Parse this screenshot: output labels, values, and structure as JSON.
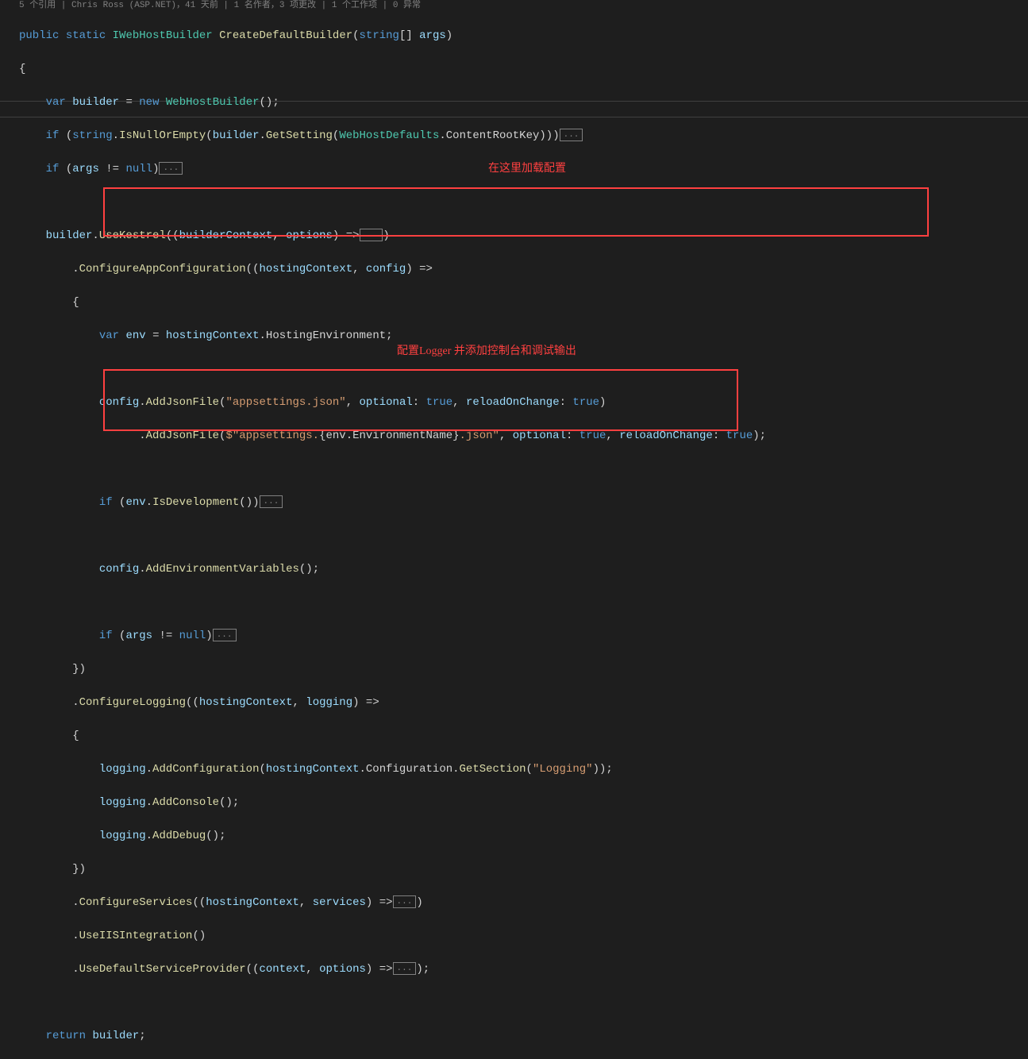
{
  "codelens": "5 个引用 | Chris Ross (ASP.NET)，41 天前 | 1 名作者，3 项更改 | 1 个工作项 | 0 异常",
  "collapsed": "...",
  "annotations": {
    "a1": "在这里加载配置",
    "a2": "配置Logger 并添加控制台和调试输出"
  },
  "tokens": {
    "public": "public",
    "static": "static",
    "IWebHostBuilder": "IWebHostBuilder",
    "CreateDefaultBuilder": "CreateDefaultBuilder",
    "string": "string",
    "brackets": "[]",
    "args": "args",
    "var": "var",
    "builder": "builder",
    "new": "new",
    "WebHostBuilder": "WebHostBuilder",
    "if": "if",
    "IsNullOrEmpty": "IsNullOrEmpty",
    "GetSetting": "GetSetting",
    "WebHostDefaults": "WebHostDefaults",
    "ContentRootKey": "ContentRootKey",
    "null": "null",
    "UseKestrel": "UseKestrel",
    "builderContext": "builderContext",
    "options": "options",
    "ConfigureAppConfiguration": "ConfigureAppConfiguration",
    "hostingContext": "hostingContext",
    "config": "config",
    "env": "env",
    "HostingEnvironment": "HostingEnvironment",
    "AddJsonFile": "AddJsonFile",
    "appsettings": "\"appsettings.json\"",
    "optional": "optional",
    "true": "true",
    "reloadOnChange": "reloadOnChange",
    "interp_start": "$\"appsettings.",
    "interp_mid": "{env.EnvironmentName}",
    "interp_end": ".json\"",
    "IsDevelopment": "IsDevelopment",
    "AddEnvironmentVariables": "AddEnvironmentVariables",
    "ConfigureLogging": "ConfigureLogging",
    "logging": "logging",
    "AddConfiguration": "AddConfiguration",
    "Configuration": "Configuration",
    "GetSection": "GetSection",
    "LoggingStr": "\"Logging\"",
    "AddConsole": "AddConsole",
    "AddDebug": "AddDebug",
    "ConfigureServices": "ConfigureServices",
    "services": "services",
    "UseIISIntegration": "UseIISIntegration",
    "UseDefaultServiceProvider": "UseDefaultServiceProvider",
    "context": "context",
    "return": "return",
    "neq": " != ",
    "eq": " = ",
    "arrow": " =>",
    "dot": ".",
    "comma": ", ",
    "colon": ": ",
    "semi": ";",
    "lp": "(",
    "rp": ")",
    "lb": "{",
    "rb": "}",
    "lpp": "((",
    "rpp": "))",
    "empty_parens": "()",
    "empty_parens_semi": "();"
  }
}
